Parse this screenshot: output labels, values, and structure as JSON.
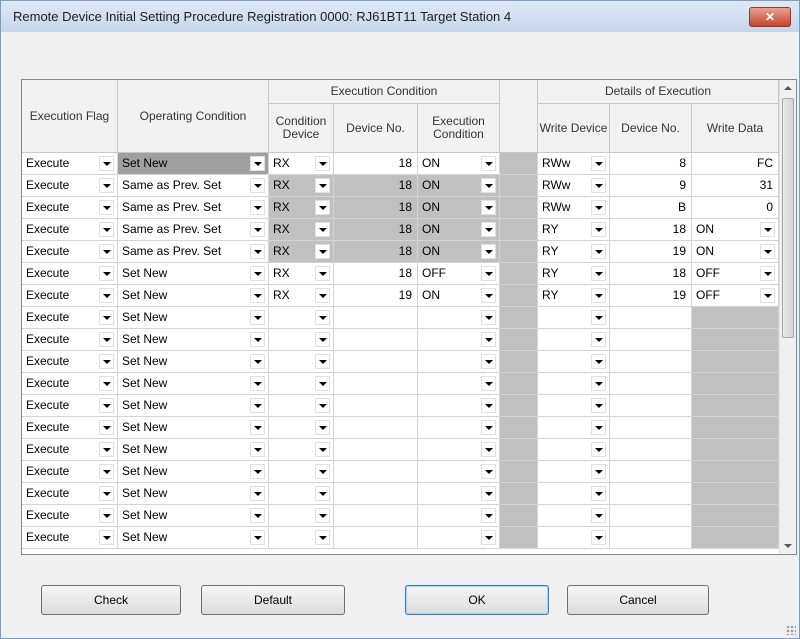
{
  "window": {
    "title": "Remote Device Initial Setting Procedure Registration 0000: RJ61BT11 Target Station 4",
    "close": "✕"
  },
  "headers": {
    "exec_flag": "Execution Flag",
    "operating_condition": "Operating Condition",
    "execution_condition_group": "Execution Condition",
    "condition_device": "Condition Device",
    "device_no_1": "Device No.",
    "execution_condition": "Execution Condition",
    "details_group": "Details of Execution",
    "write_device": "Write Device",
    "device_no_2": "Device No.",
    "write_data": "Write Data"
  },
  "rows": [
    {
      "flag": "Execute",
      "op": "Set New",
      "cdev": "RX",
      "cno": "18",
      "cond": "ON",
      "wdev": "RWw",
      "wno": "8",
      "wdata": "FC",
      "wdata_dd": false,
      "op_sel": true,
      "exec_gray": false
    },
    {
      "flag": "Execute",
      "op": "Same as Prev. Set",
      "cdev": "RX",
      "cno": "18",
      "cond": "ON",
      "wdev": "RWw",
      "wno": "9",
      "wdata": "31",
      "wdata_dd": false,
      "op_sel": false,
      "exec_gray": true
    },
    {
      "flag": "Execute",
      "op": "Same as Prev. Set",
      "cdev": "RX",
      "cno": "18",
      "cond": "ON",
      "wdev": "RWw",
      "wno": "B",
      "wdata": "0",
      "wdata_dd": false,
      "op_sel": false,
      "exec_gray": true
    },
    {
      "flag": "Execute",
      "op": "Same as Prev. Set",
      "cdev": "RX",
      "cno": "18",
      "cond": "ON",
      "wdev": "RY",
      "wno": "18",
      "wdata": "ON",
      "wdata_dd": true,
      "op_sel": false,
      "exec_gray": true
    },
    {
      "flag": "Execute",
      "op": "Same as Prev. Set",
      "cdev": "RX",
      "cno": "18",
      "cond": "ON",
      "wdev": "RY",
      "wno": "19",
      "wdata": "ON",
      "wdata_dd": true,
      "op_sel": false,
      "exec_gray": true
    },
    {
      "flag": "Execute",
      "op": "Set New",
      "cdev": "RX",
      "cno": "18",
      "cond": "OFF",
      "wdev": "RY",
      "wno": "18",
      "wdata": "OFF",
      "wdata_dd": true,
      "op_sel": false,
      "exec_gray": false
    },
    {
      "flag": "Execute",
      "op": "Set New",
      "cdev": "RX",
      "cno": "19",
      "cond": "ON",
      "wdev": "RY",
      "wno": "19",
      "wdata": "OFF",
      "wdata_dd": true,
      "op_sel": false,
      "exec_gray": false
    },
    {
      "flag": "Execute",
      "op": "Set New",
      "cdev": "",
      "cno": "",
      "cond": "",
      "wdev": "",
      "wno": "",
      "wdata": "",
      "wdata_dd": false,
      "op_sel": false,
      "exec_gray": false
    },
    {
      "flag": "Execute",
      "op": "Set New",
      "cdev": "",
      "cno": "",
      "cond": "",
      "wdev": "",
      "wno": "",
      "wdata": "",
      "wdata_dd": false,
      "op_sel": false,
      "exec_gray": false
    },
    {
      "flag": "Execute",
      "op": "Set New",
      "cdev": "",
      "cno": "",
      "cond": "",
      "wdev": "",
      "wno": "",
      "wdata": "",
      "wdata_dd": false,
      "op_sel": false,
      "exec_gray": false
    },
    {
      "flag": "Execute",
      "op": "Set New",
      "cdev": "",
      "cno": "",
      "cond": "",
      "wdev": "",
      "wno": "",
      "wdata": "",
      "wdata_dd": false,
      "op_sel": false,
      "exec_gray": false
    },
    {
      "flag": "Execute",
      "op": "Set New",
      "cdev": "",
      "cno": "",
      "cond": "",
      "wdev": "",
      "wno": "",
      "wdata": "",
      "wdata_dd": false,
      "op_sel": false,
      "exec_gray": false
    },
    {
      "flag": "Execute",
      "op": "Set New",
      "cdev": "",
      "cno": "",
      "cond": "",
      "wdev": "",
      "wno": "",
      "wdata": "",
      "wdata_dd": false,
      "op_sel": false,
      "exec_gray": false
    },
    {
      "flag": "Execute",
      "op": "Set New",
      "cdev": "",
      "cno": "",
      "cond": "",
      "wdev": "",
      "wno": "",
      "wdata": "",
      "wdata_dd": false,
      "op_sel": false,
      "exec_gray": false
    },
    {
      "flag": "Execute",
      "op": "Set New",
      "cdev": "",
      "cno": "",
      "cond": "",
      "wdev": "",
      "wno": "",
      "wdata": "",
      "wdata_dd": false,
      "op_sel": false,
      "exec_gray": false
    },
    {
      "flag": "Execute",
      "op": "Set New",
      "cdev": "",
      "cno": "",
      "cond": "",
      "wdev": "",
      "wno": "",
      "wdata": "",
      "wdata_dd": false,
      "op_sel": false,
      "exec_gray": false
    },
    {
      "flag": "Execute",
      "op": "Set New",
      "cdev": "",
      "cno": "",
      "cond": "",
      "wdev": "",
      "wno": "",
      "wdata": "",
      "wdata_dd": false,
      "op_sel": false,
      "exec_gray": false
    },
    {
      "flag": "Execute",
      "op": "Set New",
      "cdev": "",
      "cno": "",
      "cond": "",
      "wdev": "",
      "wno": "",
      "wdata": "",
      "wdata_dd": false,
      "op_sel": false,
      "exec_gray": false
    }
  ],
  "buttons": {
    "check": "Check",
    "default": "Default",
    "ok": "OK",
    "cancel": "Cancel"
  },
  "colors": {
    "cell_gray": "#c0c0c0",
    "selected_op": "#a0a0a0",
    "title_bar": "#c5d6ec",
    "close_button": "#c6432d"
  }
}
